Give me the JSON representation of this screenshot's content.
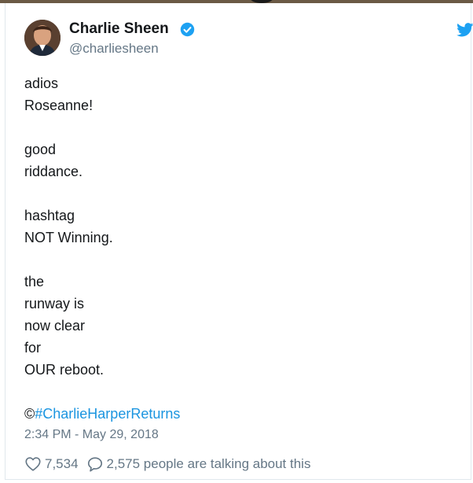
{
  "user": {
    "name": "Charlie Sheen",
    "handle": "@charliesheen"
  },
  "icons": {
    "verified": "verified-badge-icon",
    "brand": "twitter-bird-icon",
    "like": "heart-icon",
    "reply": "speech-bubble-icon"
  },
  "tweet": {
    "lines": [
      "adios",
      "Roseanne!",
      "",
      "good",
      "riddance.",
      "",
      "hashtag",
      "NOT Winning.",
      "",
      "the",
      "runway is",
      "now clear",
      "for",
      "OUR reboot."
    ],
    "copyright_symbol": "©",
    "hashtag": "#CharlieHarperReturns",
    "timestamp": "2:34 PM - May 29, 2018"
  },
  "stats": {
    "likes": "7,534",
    "talking": "2,575 people are talking about this"
  },
  "colors": {
    "link": "#1b95e0",
    "text": "#14171a",
    "secondary": "#657786",
    "brand": "#1da1f2"
  }
}
